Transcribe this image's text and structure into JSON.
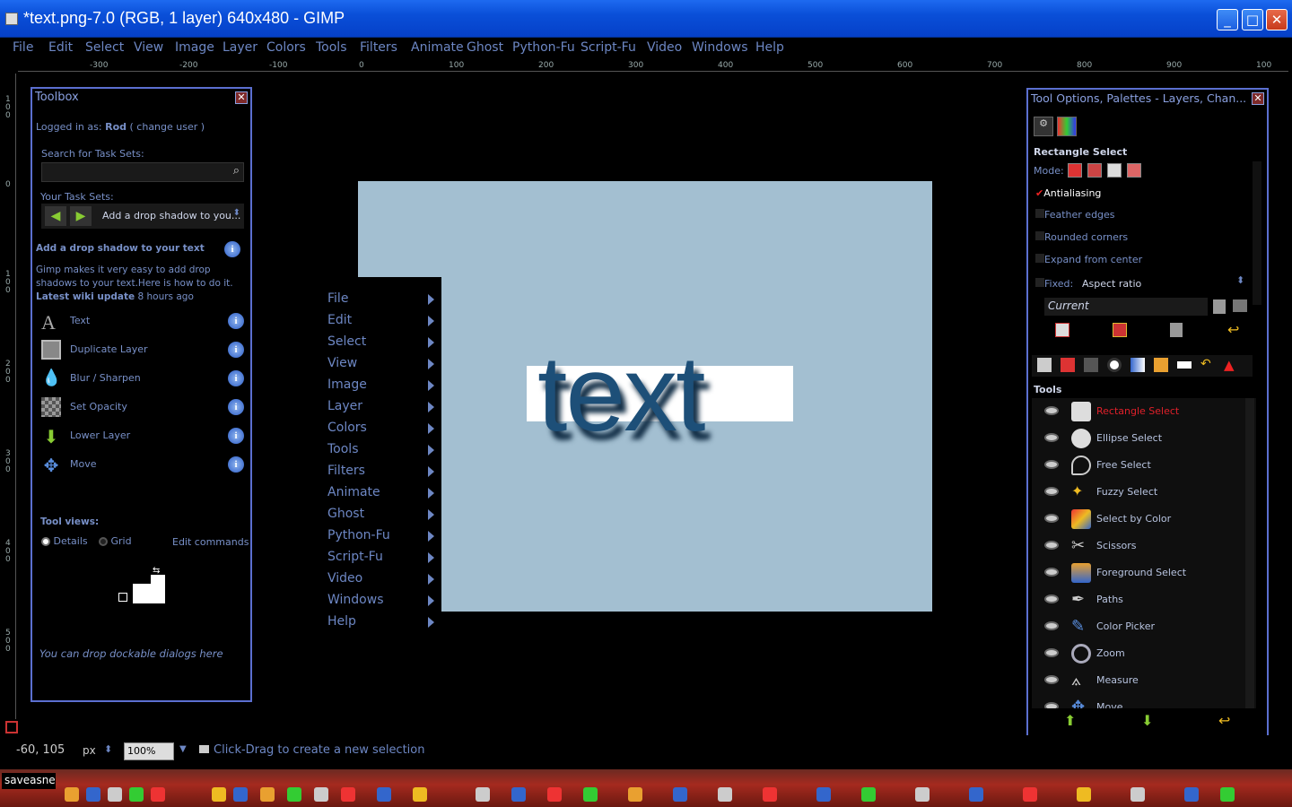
{
  "window": {
    "title": "*text.png-7.0 (RGB, 1 layer) 640x480 - GIMP",
    "minimize": "_",
    "maximize": "□",
    "close": "✕"
  },
  "menubar": [
    "File",
    "Edit",
    "Select",
    "View",
    "Image",
    "Layer",
    "Colors",
    "Tools",
    "Filters",
    "Animate",
    "Ghost",
    "Python-Fu",
    "Script-Fu",
    "Video",
    "Windows",
    "Help"
  ],
  "ruler_h_ticks": [
    "-300",
    "-200",
    "-100",
    "0",
    "100",
    "200",
    "300",
    "400",
    "500",
    "600",
    "700",
    "800",
    "900",
    "100"
  ],
  "ruler_v_ticks": [
    "100",
    "0",
    "100",
    "200",
    "300",
    "400",
    "500"
  ],
  "canvas": {
    "text": "text",
    "bg_color": "#a3bfd1"
  },
  "context_menu": [
    "File",
    "Edit",
    "Select",
    "View",
    "Image",
    "Layer",
    "Colors",
    "Tools",
    "Filters",
    "Animate",
    "Ghost",
    "Python-Fu",
    "Script-Fu",
    "Video",
    "Windows",
    "Help"
  ],
  "toolbox": {
    "title": "Toolbox",
    "logged_in_label": "Logged in as:",
    "user": "Rod",
    "paren_open": "(",
    "change_user": "change user",
    "paren_close": ")",
    "search_label": "Search for Task Sets:",
    "search_value": "",
    "task_sets_label": "Your Task Sets:",
    "task_set_selected": "Add a drop shadow to you...",
    "heading": "Add a drop shadow to your text",
    "description": "Gimp makes it very easy to add drop shadows to your text.Here is how to do it.",
    "latest_wiki": "Latest wiki update",
    "latest_time": "8 hours ago",
    "steps": [
      "Text",
      "Duplicate Layer",
      "Blur / Sharpen",
      "Set Opacity",
      "Lower Layer",
      "Move"
    ],
    "tool_views_label": "Tool views:",
    "view_details": "Details",
    "view_grid": "Grid",
    "edit_commands": "Edit commands",
    "drop_hint": "You can drop dockable dialogs here"
  },
  "tool_options": {
    "title": "Tool Options, Palettes - Layers, Chan...",
    "tool_name": "Rectangle Select",
    "mode_label": "Mode:",
    "antialiasing": "Antialiasing",
    "feather": "Feather edges",
    "rounded": "Rounded corners",
    "expand": "Expand from center",
    "fixed_label": "Fixed:",
    "fixed_value": "Aspect ratio",
    "current": "Current",
    "tools_heading": "Tools",
    "tools": [
      "Rectangle Select",
      "Ellipse Select",
      "Free Select",
      "Fuzzy Select",
      "Select by Color",
      "Scissors",
      "Foreground Select",
      "Paths",
      "Color Picker",
      "Zoom",
      "Measure",
      "Move"
    ],
    "active_tool_color": "#e0202a"
  },
  "status": {
    "coords": "-60, 105",
    "unit": "px",
    "zoom": "100%",
    "message": "Click-Drag to create a new selection"
  },
  "taskbar": {
    "start_text": "saveasne"
  }
}
